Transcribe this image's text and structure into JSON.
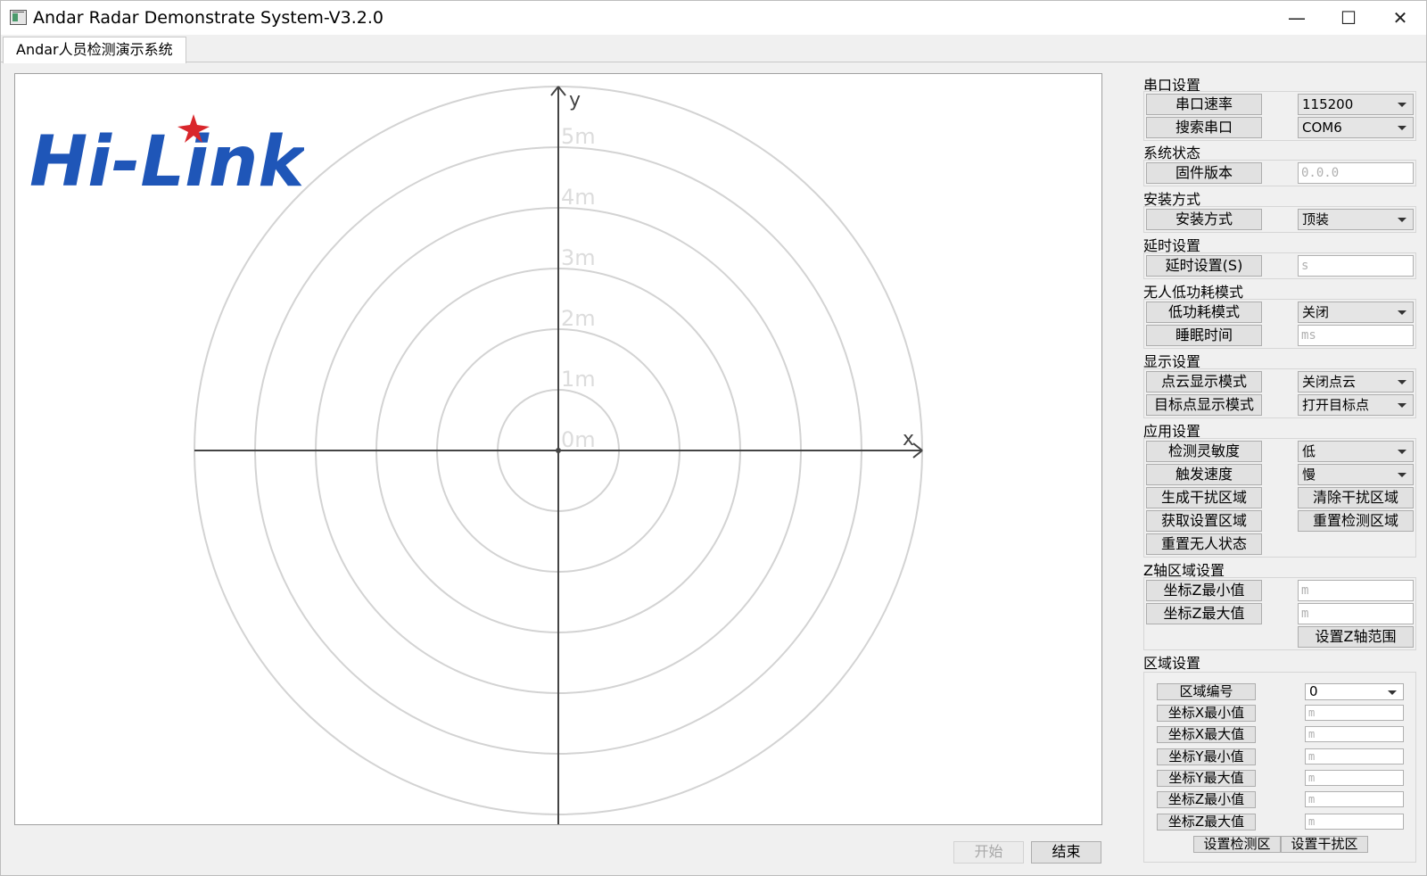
{
  "window": {
    "title": "Andar Radar Demonstrate System-V3.2.0"
  },
  "tabs": [
    {
      "label": "Andar人员检测演示系统"
    }
  ],
  "radar": {
    "ring_labels": [
      "0m",
      "1m",
      "2m",
      "3m",
      "4m",
      "5m"
    ],
    "x_axis_label": "x",
    "y_axis_label": "y",
    "logo_text": "Hi-Link",
    "colors": {
      "logo_blue": "#1f56b8",
      "logo_star": "#d9262b",
      "ring": "#d3d3d3",
      "axis": "#444444"
    }
  },
  "serial": {
    "section": "串口设置",
    "baud_button": "串口速率",
    "baud_value": "115200",
    "search_button": "搜索串口",
    "port_value": "COM6"
  },
  "system": {
    "section": "系统状态",
    "firmware_button": "固件版本",
    "firmware_value": "0.0.0"
  },
  "install": {
    "section": "安装方式",
    "button": "安装方式",
    "value": "顶装"
  },
  "delay": {
    "section": "延时设置",
    "button": "延时设置(S)",
    "placeholder": "s"
  },
  "lowpower": {
    "section": "无人低功耗模式",
    "mode_button": "低功耗模式",
    "mode_value": "关闭",
    "sleep_button": "睡眠时间",
    "sleep_placeholder": "ms"
  },
  "display": {
    "section": "显示设置",
    "cloud_button": "点云显示模式",
    "cloud_value": "关闭点云",
    "target_button": "目标点显示模式",
    "target_value": "打开目标点"
  },
  "app": {
    "section": "应用设置",
    "sensitivity_button": "检测灵敏度",
    "sensitivity_value": "低",
    "trigger_button": "触发速度",
    "trigger_value": "慢",
    "gen_interference": "生成干扰区域",
    "clear_interference": "清除干扰区域",
    "get_area": "获取设置区域",
    "reset_area": "重置检测区域",
    "reset_empty": "重置无人状态"
  },
  "zaxis": {
    "section": "Z轴区域设置",
    "zmin_button": "坐标Z最小值",
    "zmin_placeholder": "m",
    "zmax_button": "坐标Z最大值",
    "zmax_placeholder": "m",
    "set_button": "设置Z轴范围"
  },
  "region": {
    "section": "区域设置",
    "id_button": "区域编号",
    "id_value": "0",
    "xmin": "坐标X最小值",
    "xmax": "坐标X最大值",
    "ymin": "坐标Y最小值",
    "ymax": "坐标Y最大值",
    "zmin": "坐标Z最小值",
    "zmax": "坐标Z最大值",
    "placeholder": "m",
    "set_detect": "设置检测区",
    "set_interference": "设置干扰区"
  },
  "bottom": {
    "start": "开始",
    "end": "结束"
  }
}
